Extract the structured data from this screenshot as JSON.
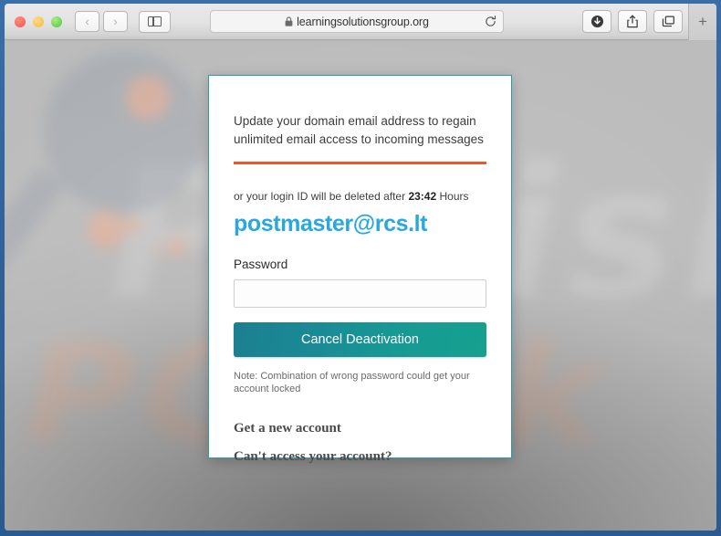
{
  "browser": {
    "traffic_lights": [
      "close",
      "minimize",
      "maximize"
    ],
    "back_label": "‹",
    "forward_label": "›",
    "sidebar_name": "sidebar-toggle",
    "url": "learningsolutionsgroup.org",
    "lock_icon": "lock-icon",
    "reload_icon": "reload-icon",
    "downloads_icon": "downloads-icon",
    "share_icon": "share-icon",
    "tabs_icon": "tab-overview-icon",
    "new_tab_label": "+"
  },
  "background": {
    "watermark_text": "PCrisk",
    "watermark_text_2": "PCrisk",
    "logo_name": "magnifier-logo"
  },
  "card": {
    "headline": "Update your domain email address to regain unlimited email access to incoming messages",
    "warning_prefix": "or your login ID will be deleted after ",
    "warning_time": "23:42",
    "warning_suffix": " Hours",
    "email": "postmaster@rcs.lt",
    "password_label": "Password",
    "password_value": "",
    "password_placeholder": "",
    "submit_label": "Cancel Deactivation",
    "note": "Note: Combination of wrong password could get your account locked",
    "links": [
      {
        "label": "Get a new account"
      },
      {
        "label": "Can't access your account?"
      }
    ]
  },
  "colors": {
    "card_border": "#2e9aa8",
    "divider_orange": "#f2552c",
    "email_blue": "#29a8e0",
    "button_gradient_start": "#1c7f90",
    "button_gradient_end": "#16a08e",
    "window_frame_blue": "#2f6099"
  }
}
